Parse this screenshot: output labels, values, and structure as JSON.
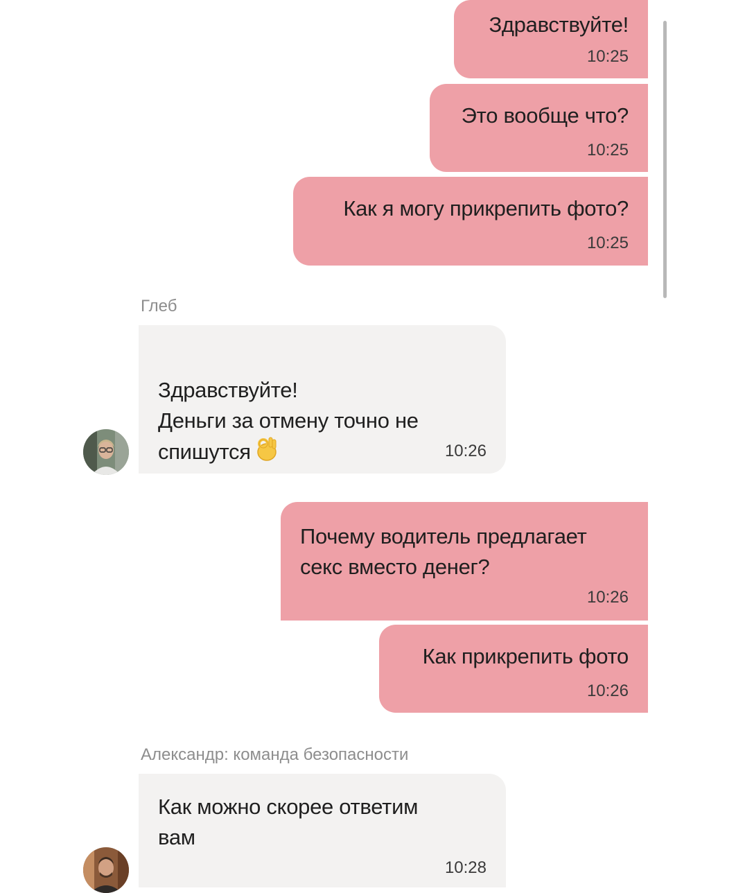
{
  "messages": [
    {
      "id": "m1",
      "direction": "outgoing",
      "text": "Здравствуйте!",
      "time": "10:25"
    },
    {
      "id": "m2",
      "direction": "outgoing",
      "text": "Это вообще что?",
      "time": "10:25"
    },
    {
      "id": "m3",
      "direction": "outgoing",
      "text": "Как я могу прикрепить фото?",
      "time": "10:25"
    },
    {
      "id": "m4",
      "direction": "incoming",
      "sender": "Глеб",
      "text": "Здравствуйте!\nДеньги за отмену точно не\nспишутся",
      "emoji": "ok-hand-icon",
      "time": "10:26"
    },
    {
      "id": "m5",
      "direction": "outgoing",
      "text": "Почему водитель предлагает\nсекс вместо денег?",
      "time": "10:26"
    },
    {
      "id": "m6",
      "direction": "outgoing",
      "text": "Как прикрепить фото",
      "time": "10:26"
    },
    {
      "id": "m7",
      "direction": "incoming",
      "sender": "Александр: команда безопасности",
      "text": "Как можно скорее ответим\nвам",
      "time": "10:28"
    }
  ],
  "colors": {
    "outgoing_bubble": "#eea0a7",
    "incoming_bubble": "#f3f2f1",
    "sender_name": "#8d8d8d",
    "background": "#ffffff"
  }
}
